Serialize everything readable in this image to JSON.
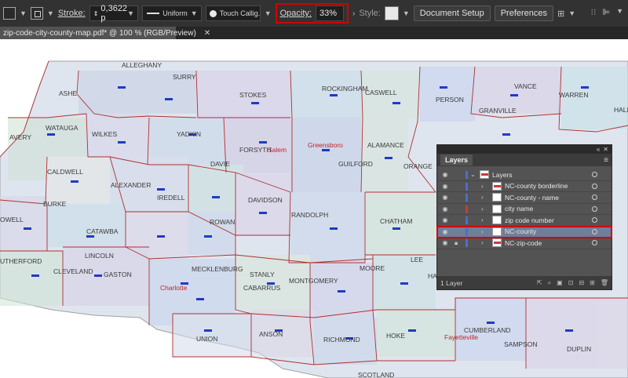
{
  "control_bar": {
    "stroke_label": "Stroke:",
    "stroke_weight": "0,3622 p",
    "stroke_profile": "Uniform",
    "brush": "Touch Callig...",
    "opacity_label": "Opacity:",
    "opacity_value": "33%",
    "style_label": "Style:",
    "document_setup": "Document Setup",
    "preferences": "Preferences"
  },
  "document_tab": {
    "title": "zip-code-city-county-map.pdf* @ 100 % (RGB/Preview)",
    "close": "✕"
  },
  "map": {
    "counties": [
      "ALLEGHANY",
      "SURRY",
      "STOKES",
      "ROCKINGHAM",
      "CASWELL",
      "PERSON",
      "VANCE",
      "WARREN",
      "HALIF",
      "GRANVILLE",
      "ASHE",
      "WATAUGA",
      "WILKES",
      "YADKIN",
      "FORSYTH",
      "Salem",
      "Greensboro",
      "ALAMANCE",
      "GUILFORD",
      "ORANGE",
      "AVERY",
      "CALDWELL",
      "DAVIE",
      "ALEXANDER",
      "IREDELL",
      "DAVIDSON",
      "RANDOLPH",
      "CHATHAM",
      "BURKE",
      "ROWAN",
      "OWELL",
      "CATAWBA",
      "LINCOLN",
      "MECKLENBURG",
      "STANLY",
      "MONTGOMERY",
      "MOORE",
      "LEE",
      "HA",
      "UTHERFORD",
      "CLEVELAND",
      "GASTON",
      "Charlotte",
      "CABARRUS",
      "UNION",
      "ANSON",
      "RICHMOND",
      "HOKE",
      "CUMBERLAND",
      "Fayetteville",
      "SAMPSON",
      "DUPLIN",
      "SCOTLAND"
    ]
  },
  "layers_panel": {
    "collapse": "«",
    "close": "✕",
    "title": "Layers",
    "menu": "≡",
    "rows": [
      {
        "name": "Layers",
        "level": 0
      },
      {
        "name": "NC-county borderline",
        "level": 1
      },
      {
        "name": "NC-county - name",
        "level": 1
      },
      {
        "name": "city name",
        "level": 1
      },
      {
        "name": "zip code number",
        "level": 1
      },
      {
        "name": "NC-county",
        "level": 1
      },
      {
        "name": "NC-zip-code",
        "level": 1
      }
    ],
    "footer": "1 Layer"
  },
  "colors": {
    "highlight_red": "#d40000",
    "county_line": "#b03030",
    "panel_selection": "#6e7f99"
  }
}
